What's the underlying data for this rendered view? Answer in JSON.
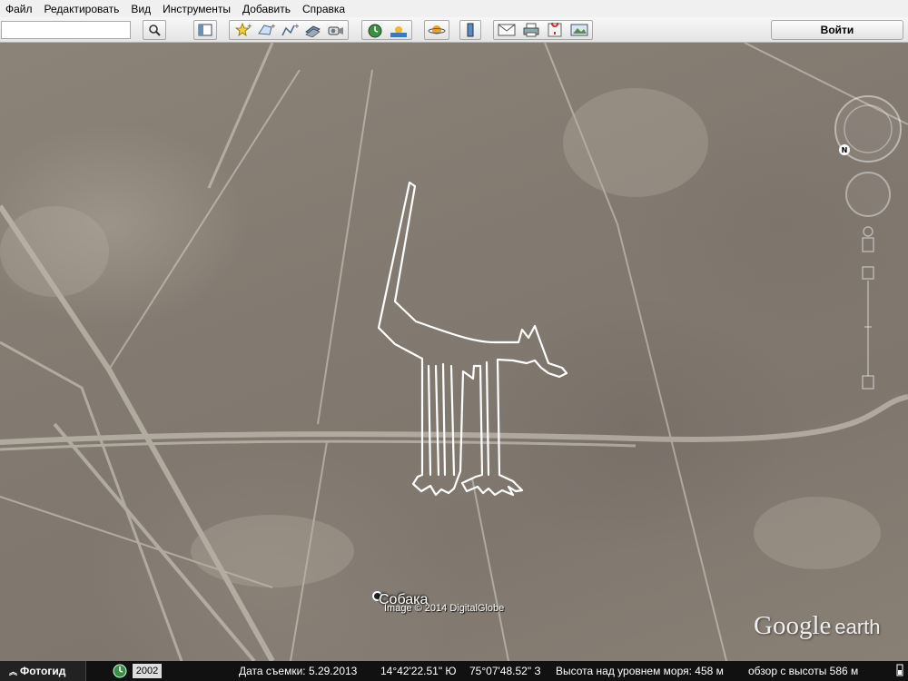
{
  "menu": [
    "Файл",
    "Редактировать",
    "Вид",
    "Инструменты",
    "Добавить",
    "Справка"
  ],
  "toolbar": {
    "search_value": "",
    "login_label": "Войти",
    "buttons": [
      "search-icon",
      "sidebar-icon",
      "placemark-icon",
      "polygon-icon",
      "path-icon",
      "image-overlay-icon",
      "record-tour-icon",
      "historical-imagery-icon",
      "sunlight-icon",
      "planets-icon",
      "ruler-icon",
      "email-icon",
      "print-icon",
      "view-in-maps-icon",
      "save-image-icon"
    ]
  },
  "map": {
    "place_label": "Собака",
    "imagery_credit": "Image © 2014 DigitalGlobe",
    "brand_google": "Google",
    "brand_earth": "earth"
  },
  "statusbar": {
    "tour_label": "Фотогид",
    "year": "2002",
    "imagery_date": "Дата съемки: 5.29.2013",
    "latitude": "14°42'22.51\" Ю",
    "longitude": "75°07'48.52\" З",
    "elevation": "Высота над уровнем моря:  458 м",
    "eye_alt": "обзор с высоты  586 м"
  },
  "colors": {
    "statusbar": "#111111",
    "terrain": "#857c72",
    "geoglyph_line": "#ffffff"
  }
}
